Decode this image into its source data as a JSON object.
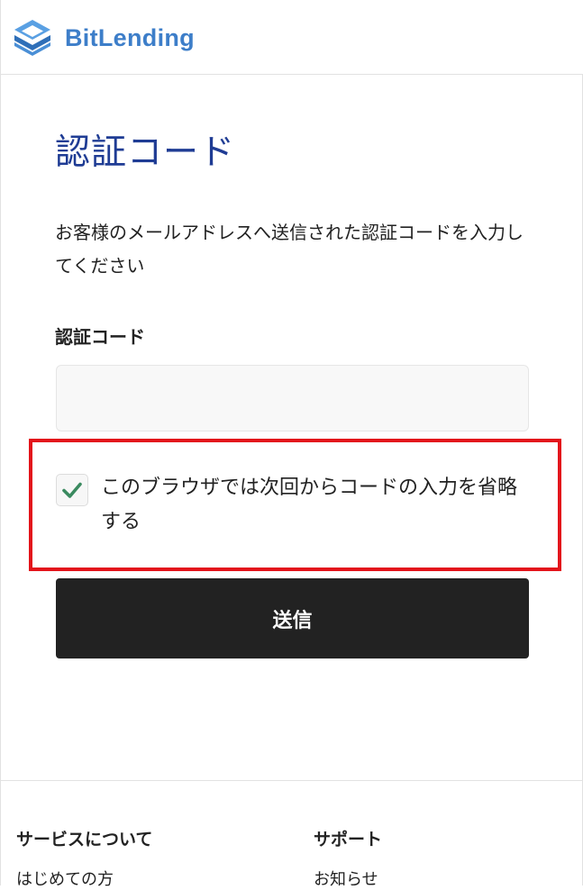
{
  "header": {
    "logo_text": "BitLending",
    "brand_color": "#3d7ec9"
  },
  "main": {
    "title": "認証コード",
    "description": "お客様のメールアドレスへ送信された認証コードを入力してください",
    "code_label": "認証コード",
    "code_value": "",
    "remember_label": "このブラウザでは次回からコードの入力を省略する",
    "remember_checked": true,
    "submit_label": "送信",
    "title_color": "#1f3c94",
    "highlight_color": "#e3141b",
    "check_color": "#3a8a5f"
  },
  "footer": {
    "columns": [
      {
        "heading": "サービスについて",
        "links": [
          "はじめての方"
        ]
      },
      {
        "heading": "サポート",
        "links": [
          "お知らせ"
        ]
      }
    ]
  }
}
